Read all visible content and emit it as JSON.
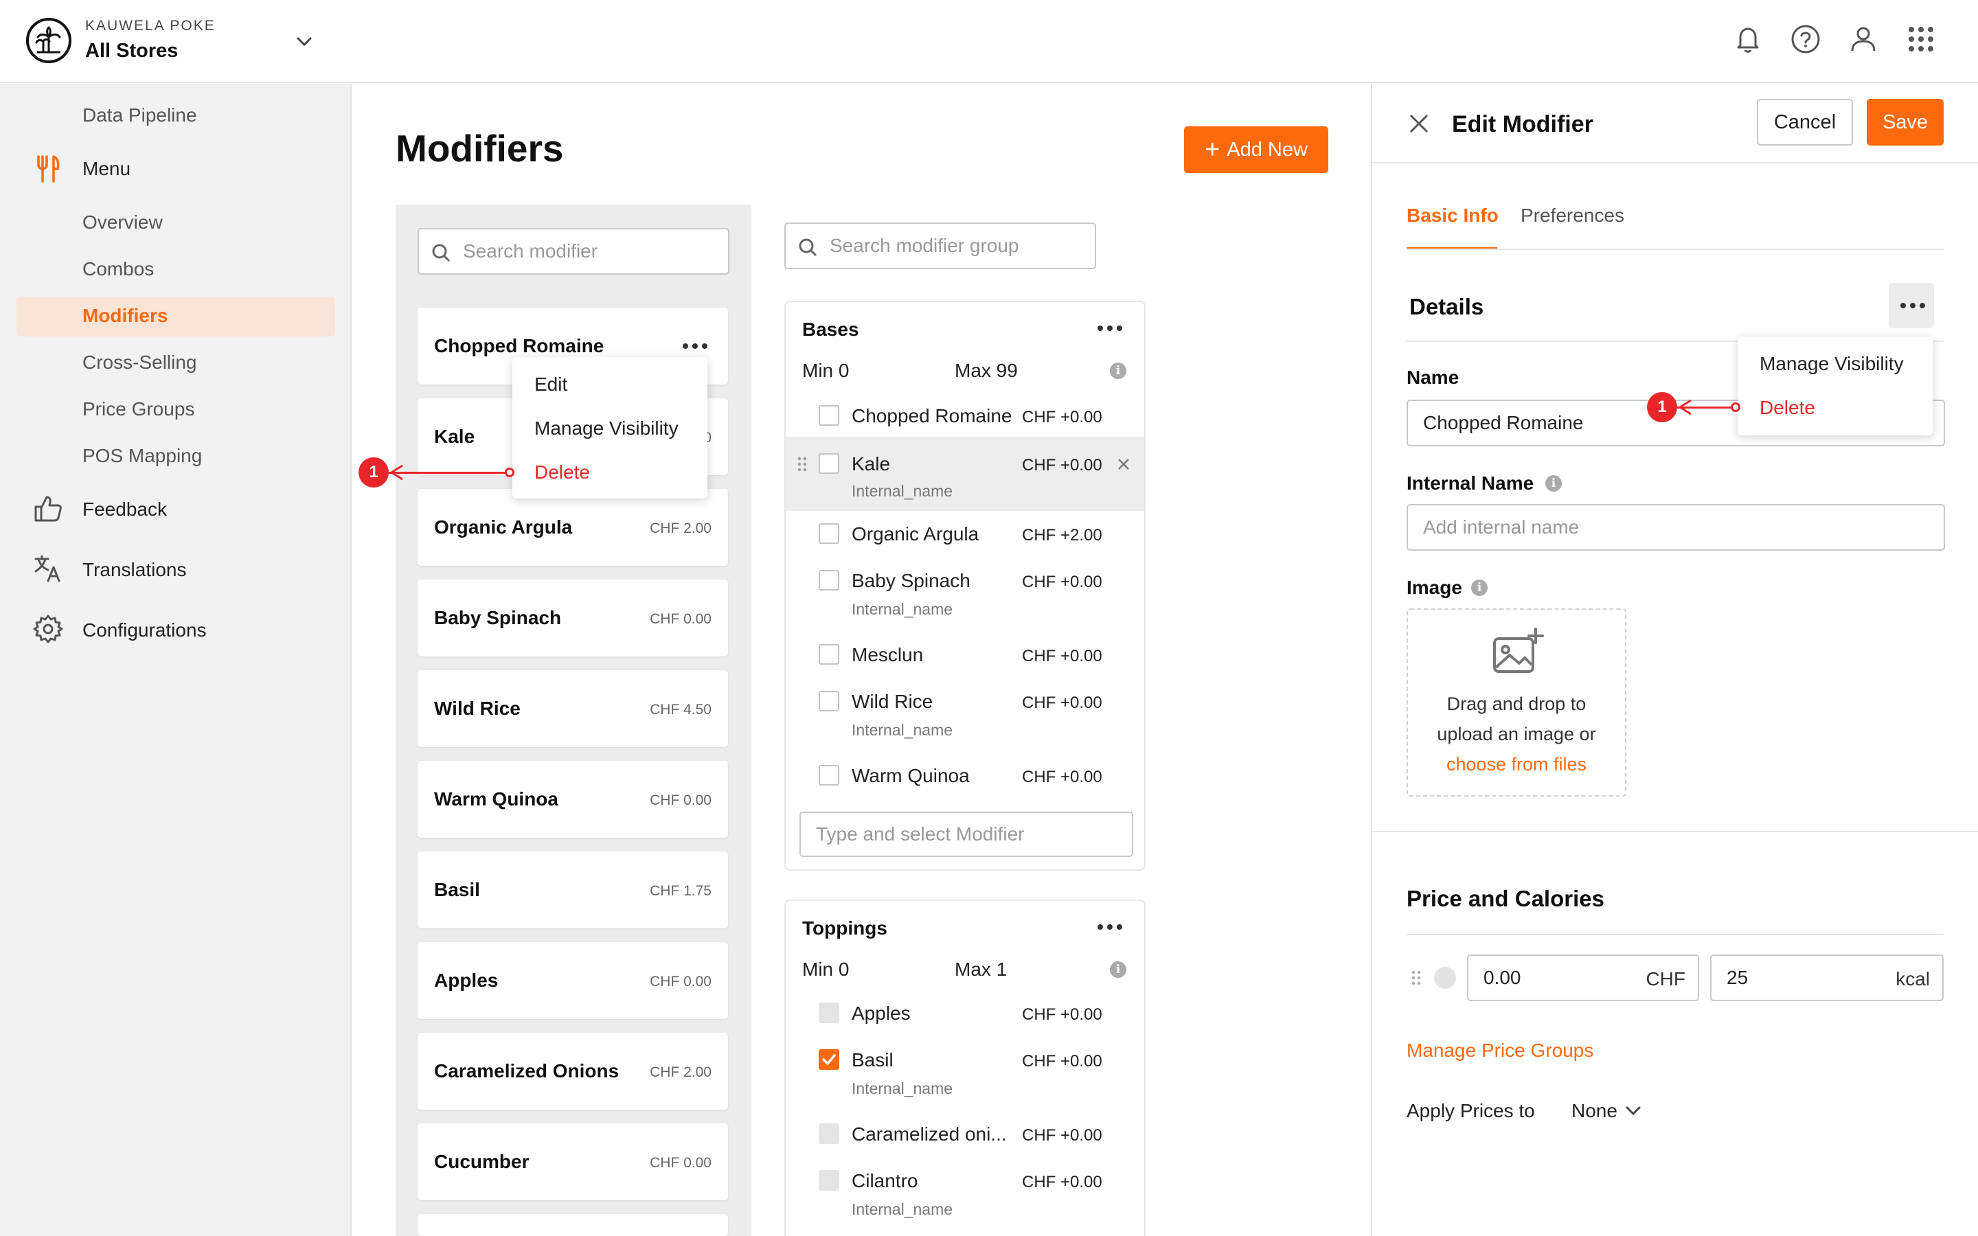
{
  "header": {
    "brand_small": "KAUWELA POKE",
    "store": "All Stores"
  },
  "sidebar": {
    "data_pipeline": "Data Pipeline",
    "menu": "Menu",
    "sub_items": [
      "Overview",
      "Combos",
      "Modifiers",
      "Cross-Selling",
      "Price Groups",
      "POS Mapping"
    ],
    "active_item": "Modifiers",
    "feedback": "Feedback",
    "translations": "Translations",
    "configurations": "Configurations"
  },
  "main": {
    "title": "Modifiers",
    "add_new": "Add New",
    "search_modifier_placeholder": "Search modifier",
    "search_group_placeholder": "Search modifier group",
    "modifiers": [
      {
        "name": "Chopped Romaine",
        "price": ""
      },
      {
        "name": "Kale",
        "price": ""
      },
      {
        "name": "Organic Argula",
        "price": "CHF 2.00"
      },
      {
        "name": "Baby Spinach",
        "price": "CHF 0.00"
      },
      {
        "name": "Wild Rice",
        "price": "CHF 4.50"
      },
      {
        "name": "Warm Quinoa",
        "price": "CHF 0.00"
      },
      {
        "name": "Basil",
        "price": "CHF 1.75"
      },
      {
        "name": "Apples",
        "price": "CHF 0.00"
      },
      {
        "name": "Caramelized Onions",
        "price": "CHF 2.00"
      },
      {
        "name": "Cucumber",
        "price": "CHF 0.00"
      }
    ],
    "kale_price_partial": "0",
    "context_menu": {
      "edit": "Edit",
      "manage_visibility": "Manage Visibility",
      "delete": "Delete"
    },
    "annotation_badge": "1"
  },
  "groups": {
    "bases": {
      "title": "Bases",
      "min": "Min 0",
      "max": "Max 99",
      "items": [
        {
          "name": "Chopped Romaine",
          "price": "CHF +0.00",
          "sub": ""
        },
        {
          "name": "Kale",
          "price": "CHF +0.00",
          "sub": "Internal_name"
        },
        {
          "name": "Organic Argula",
          "price": "CHF +2.00",
          "sub": ""
        },
        {
          "name": "Baby Spinach",
          "price": "CHF +0.00",
          "sub": "Internal_name"
        },
        {
          "name": "Mesclun",
          "price": "CHF +0.00",
          "sub": ""
        },
        {
          "name": "Wild Rice",
          "price": "CHF +0.00",
          "sub": "Internal_name"
        },
        {
          "name": "Warm Quinoa",
          "price": "CHF +0.00",
          "sub": ""
        }
      ],
      "type_placeholder": "Type and select Modifier"
    },
    "toppings": {
      "title": "Toppings",
      "min": "Min 0",
      "max": "Max 1",
      "items": [
        {
          "name": "Apples",
          "price": "CHF +0.00",
          "sub": "",
          "state": "disabled"
        },
        {
          "name": "Basil",
          "price": "CHF +0.00",
          "sub": "Internal_name",
          "state": "checked"
        },
        {
          "name": "Caramelized oni...",
          "price": "CHF +0.00",
          "sub": "",
          "state": "disabled"
        },
        {
          "name": "Cilantro",
          "price": "CHF +0.00",
          "sub": "Internal_name",
          "state": "disabled"
        }
      ]
    }
  },
  "edit_panel": {
    "title": "Edit Modifier",
    "cancel": "Cancel",
    "save": "Save",
    "tabs": [
      "Basic Info",
      "Preferences"
    ],
    "active_tab": "Basic Info",
    "details": "Details",
    "menu": {
      "manage_visibility": "Manage Visibility",
      "delete": "Delete"
    },
    "name_label": "Name",
    "name_value": "Chopped Romaine",
    "internal_label": "Internal Name",
    "internal_placeholder": "Add internal name",
    "image_label": "Image",
    "drop_line1": "Drag and drop to",
    "drop_line2": "upload an image or",
    "drop_link": "choose from files",
    "price_section": "Price and Calories",
    "price_value": "0.00",
    "price_unit": "CHF",
    "kcal_value": "25",
    "kcal_unit": "kcal",
    "manage_price_groups": "Manage Price Groups",
    "apply_prices_label": "Apply Prices to",
    "apply_prices_value": "None",
    "annotation_badge": "1"
  },
  "colors": {
    "accent": "#fd6a0e",
    "annotation": "#e8262a",
    "active_bg": "#fae3d7"
  }
}
